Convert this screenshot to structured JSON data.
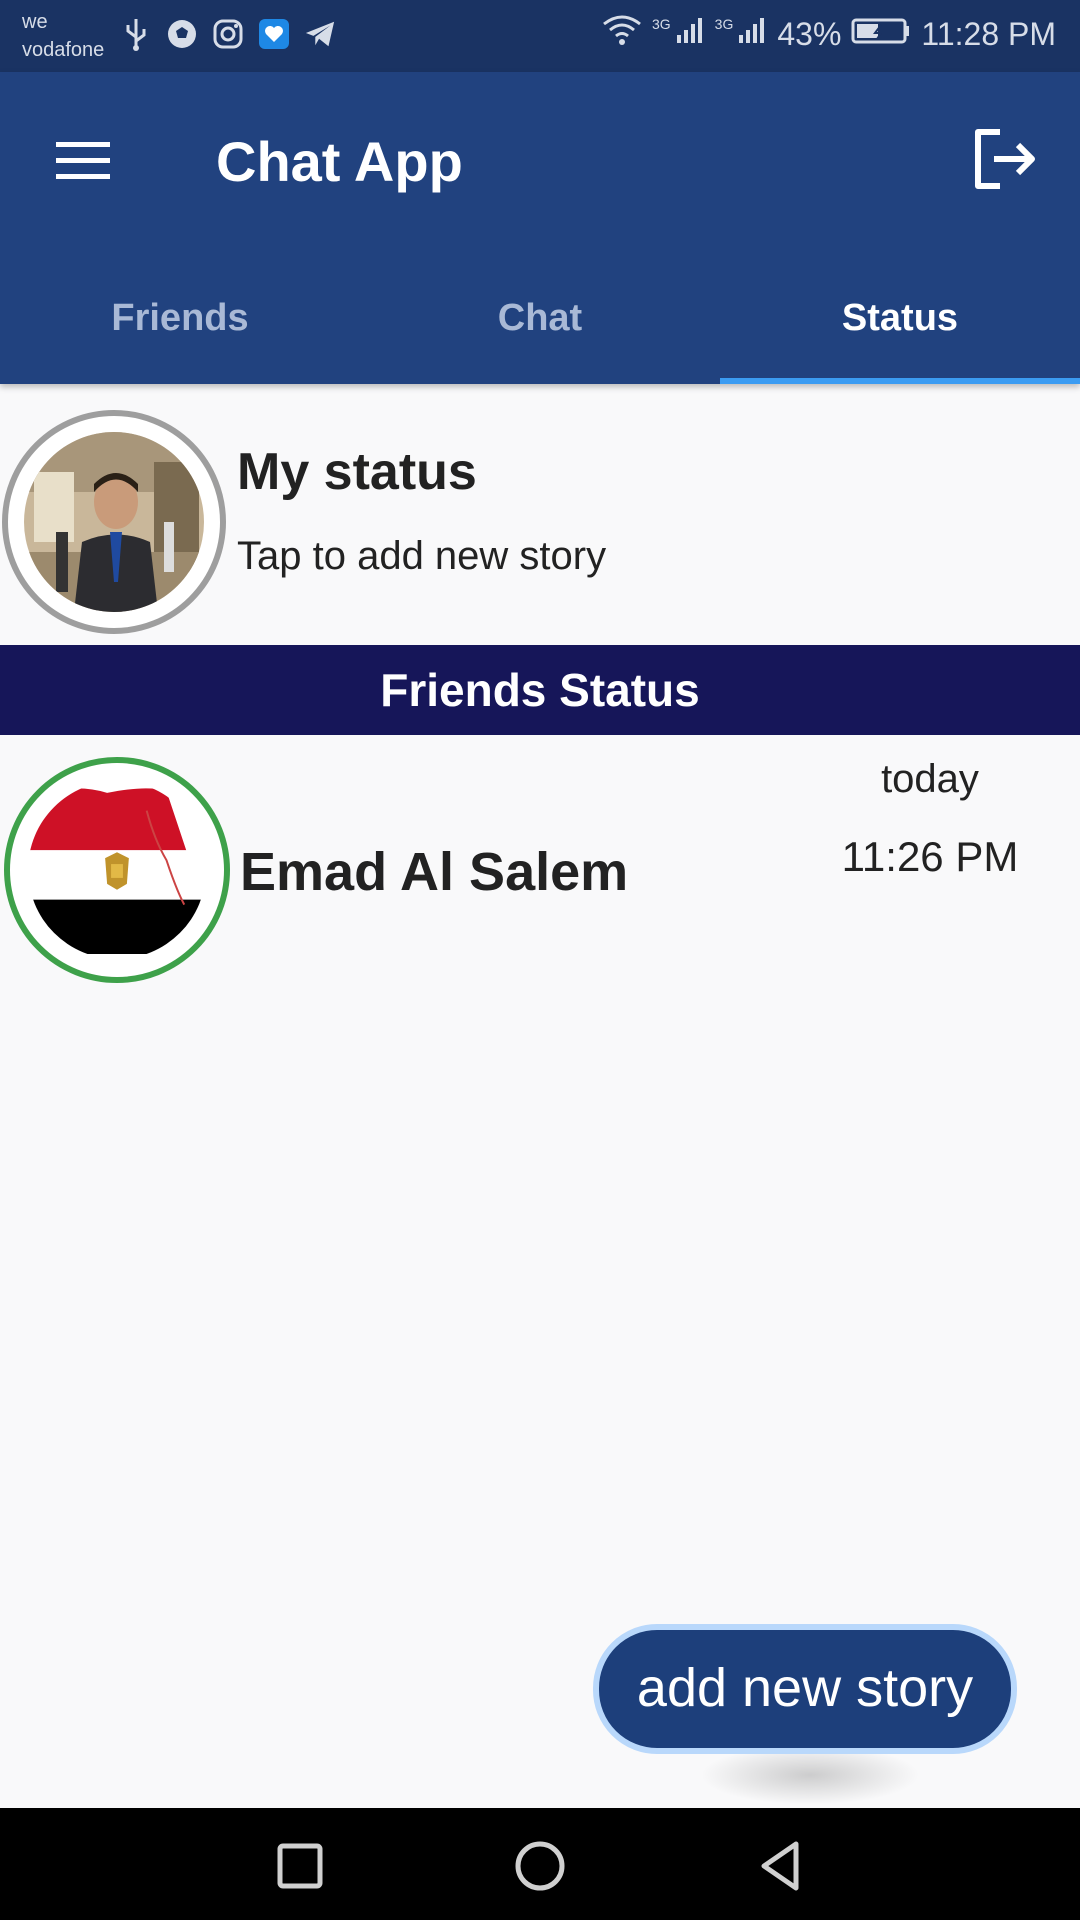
{
  "status_bar": {
    "carrier_line1": "we",
    "carrier_line2": "vodafone",
    "network_1": "3G",
    "network_2": "3G",
    "battery": "43%",
    "time": "11:28 PM"
  },
  "app_bar": {
    "title": "Chat App",
    "menu_icon": "hamburger-menu-icon",
    "logout_icon": "logout-icon"
  },
  "tabs": [
    {
      "label": "Friends",
      "active": false
    },
    {
      "label": "Chat",
      "active": false
    },
    {
      "label": "Status",
      "active": true
    }
  ],
  "my_status": {
    "title": "My status",
    "subtitle": "Tap to add new story"
  },
  "friends_section": {
    "header": "Friends Status",
    "items": [
      {
        "name": "Emad Al Salem",
        "day": "today",
        "time": "11:26 PM"
      }
    ]
  },
  "fab": {
    "label": "add new story"
  },
  "colors": {
    "status_bar": "#1a3363",
    "app_bar": "#21427f",
    "tab_indicator": "#3b9cf2",
    "section_header": "#161659",
    "friend_ring": "#3ea14a",
    "my_ring": "#9e9e9e",
    "fab": "#1d3f7b"
  }
}
